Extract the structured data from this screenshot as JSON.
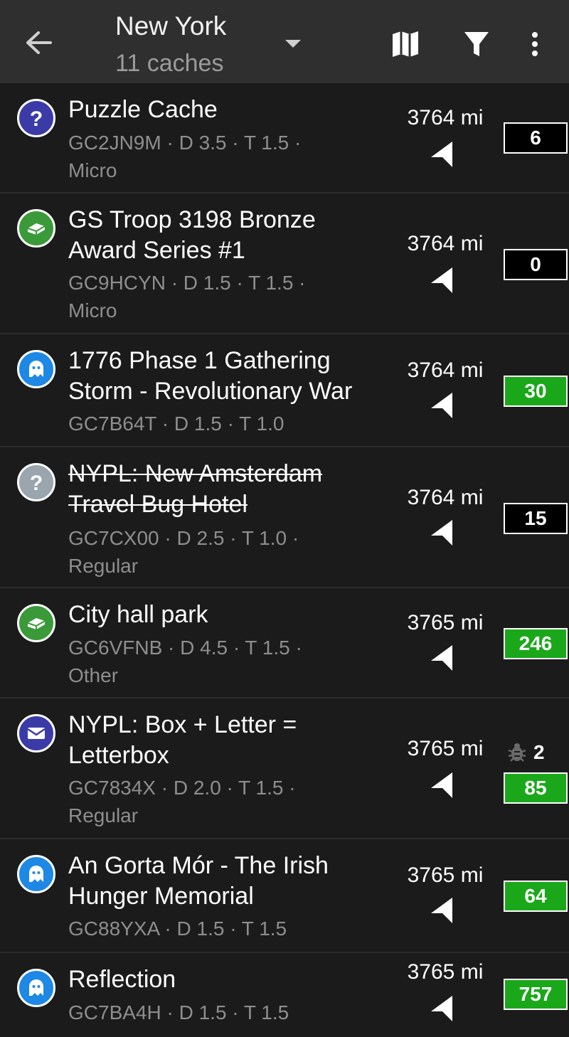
{
  "toolbar": {
    "title": "New York",
    "subtitle": "11 caches",
    "icons": [
      "back-arrow-icon",
      "dropdown-arrow-icon",
      "map-icon",
      "filter-icon",
      "more-vert-icon"
    ]
  },
  "colors": {
    "toolbar_bg": "#2f2f2f",
    "list_bg": "#1b1b1b",
    "badge_green": "#1aa81a",
    "badge_black": "#000000",
    "icon_mystery": "#3b3ba8",
    "icon_traditional": "#3a9a3a",
    "icon_event": "#1e88e5",
    "icon_disabled": "#9aa5ad",
    "icon_letterbox": "#3b3ba8"
  },
  "caches": [
    {
      "type": "mystery",
      "icon": "question-mark-icon",
      "name": "Puzzle Cache",
      "meta1": "GC2JN9M · D 3.5 · T 1.5 ·",
      "meta2": "Micro",
      "distance": "3764 mi",
      "count": "6",
      "badge": "black",
      "strike": false
    },
    {
      "type": "traditional",
      "icon": "traditional-cache-icon",
      "name": "GS Troop 3198 Bronze Award Series #1",
      "meta1": "GC9HCYN · D 1.5 · T 1.5 ·",
      "meta2": "Micro",
      "distance": "3764 mi",
      "count": "0",
      "badge": "black",
      "strike": false
    },
    {
      "type": "event",
      "icon": "ghost-event-icon",
      "name": "1776 Phase 1 Gathering Storm - Revolutionary War",
      "meta1": "GC7B64T · D 1.5 · T 1.0",
      "meta2": "",
      "distance": "3764 mi",
      "count": "30",
      "badge": "green",
      "strike": false
    },
    {
      "type": "disabled-mystery",
      "icon": "question-mark-icon",
      "name": "NYPL: New Amsterdam Travel Bug Hotel",
      "meta1": "GC7CX00 · D 2.5 · T 1.0 ·",
      "meta2": "Regular",
      "distance": "3764 mi",
      "count": "15",
      "badge": "black",
      "strike": true
    },
    {
      "type": "traditional",
      "icon": "traditional-cache-icon",
      "name": "City hall park",
      "meta1": "GC6VFNB · D 4.5 · T 1.5 ·",
      "meta2": "Other",
      "distance": "3765 mi",
      "count": "246",
      "badge": "green",
      "strike": false
    },
    {
      "type": "letterbox",
      "icon": "envelope-icon",
      "name": "NYPL: Box + Letter = Letterbox",
      "meta1": "GC7834X · D 2.0 · T 1.5 ·",
      "meta2": "Regular",
      "distance": "3765 mi",
      "count": "85",
      "badge": "green",
      "strike": false,
      "trackables": "2"
    },
    {
      "type": "event",
      "icon": "ghost-event-icon",
      "name": "An Gorta Mór - The Irish Hunger Memorial",
      "meta1": "GC88YXA · D 1.5 · T 1.5",
      "meta2": "",
      "distance": "3765 mi",
      "count": "64",
      "badge": "green",
      "strike": false
    },
    {
      "type": "event",
      "icon": "ghost-event-icon",
      "name": "Reflection",
      "meta1": "GC7BA4H · D 1.5 · T 1.5",
      "meta2": "",
      "distance": "3765 mi",
      "count": "757",
      "badge": "green",
      "strike": false
    }
  ]
}
